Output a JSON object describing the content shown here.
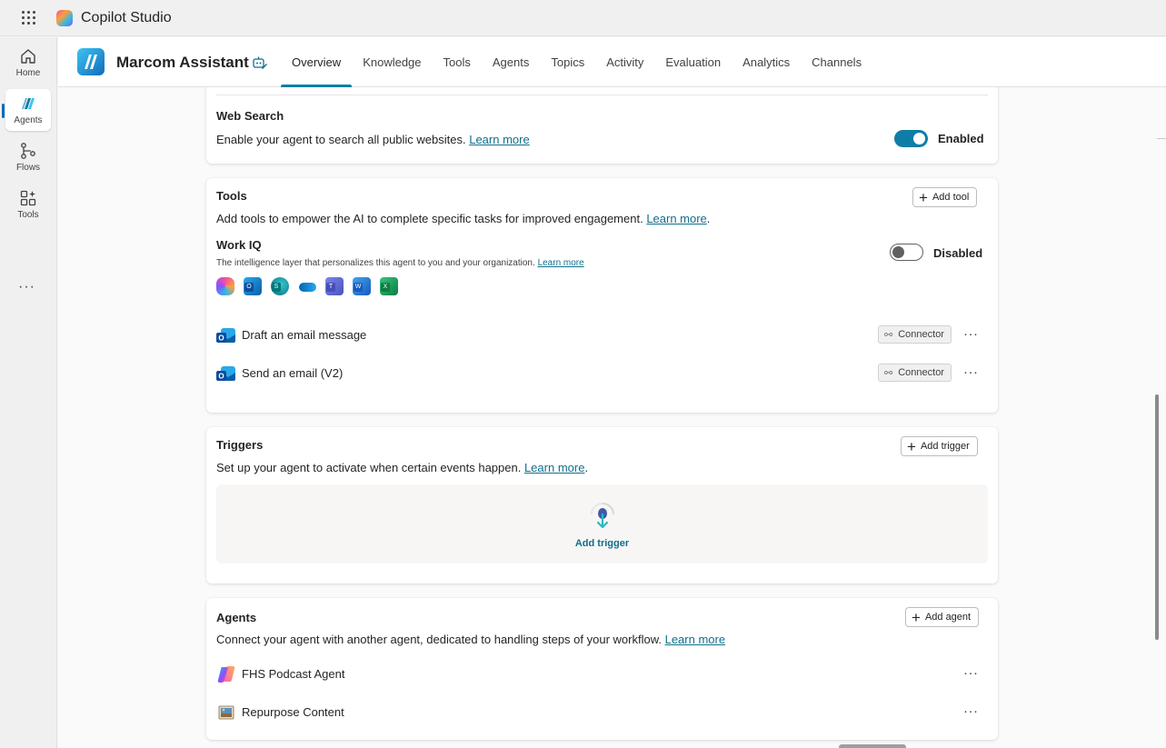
{
  "app": {
    "title": "Copilot Studio"
  },
  "rail": {
    "items": [
      {
        "label": "Home",
        "icon": "home-icon"
      },
      {
        "label": "Agents",
        "icon": "agents-icon"
      },
      {
        "label": "Flows",
        "icon": "flows-icon"
      },
      {
        "label": "Tools",
        "icon": "tools-icon"
      }
    ],
    "more": "···"
  },
  "agent": {
    "name": "Marcom Assistant",
    "tabs": [
      "Overview",
      "Knowledge",
      "Tools",
      "Agents",
      "Topics",
      "Activity",
      "Evaluation",
      "Analytics",
      "Channels"
    ],
    "active_tab": "Overview"
  },
  "web_search": {
    "title": "Web Search",
    "desc": "Enable your agent to search all public websites. ",
    "link": "Learn more",
    "toggle_state": "Enabled"
  },
  "tools": {
    "title": "Tools",
    "add_label": "Add tool",
    "desc": "Add tools to empower the AI to complete specific tasks for improved engagement. ",
    "link": "Learn more",
    "link_suffix": ".",
    "workiq": {
      "title": "Work IQ",
      "desc": "The intelligence layer that personalizes this agent to you and your organization. ",
      "link": "Learn more",
      "toggle_state": "Disabled",
      "apps": [
        "copilot-icon",
        "outlook-icon",
        "sharepoint-icon",
        "onedrive-icon",
        "teams-icon",
        "word-icon",
        "excel-icon"
      ]
    },
    "items": [
      {
        "name": "Draft an email message",
        "badge": "Connector",
        "icon": "outlook-icon"
      },
      {
        "name": "Send an email (V2)",
        "badge": "Connector",
        "icon": "outlook-icon"
      }
    ],
    "more": "···"
  },
  "triggers": {
    "title": "Triggers",
    "add_label": "Add trigger",
    "desc": "Set up your agent to activate when certain events happen. ",
    "link": "Learn more",
    "link_suffix": ".",
    "empty_label": "Add trigger"
  },
  "agents_section": {
    "title": "Agents",
    "add_label": "Add agent",
    "desc": "Connect your agent with another agent, dedicated to handling steps of your workflow. ",
    "link": "Learn more",
    "items": [
      {
        "name": "FHS Podcast Agent",
        "icon": "copilot-icon"
      },
      {
        "name": "Repurpose Content",
        "icon": "image-icon"
      }
    ],
    "more": "···"
  },
  "colors": {
    "accent": "#0f7da8",
    "link": "#0f6f8c"
  }
}
